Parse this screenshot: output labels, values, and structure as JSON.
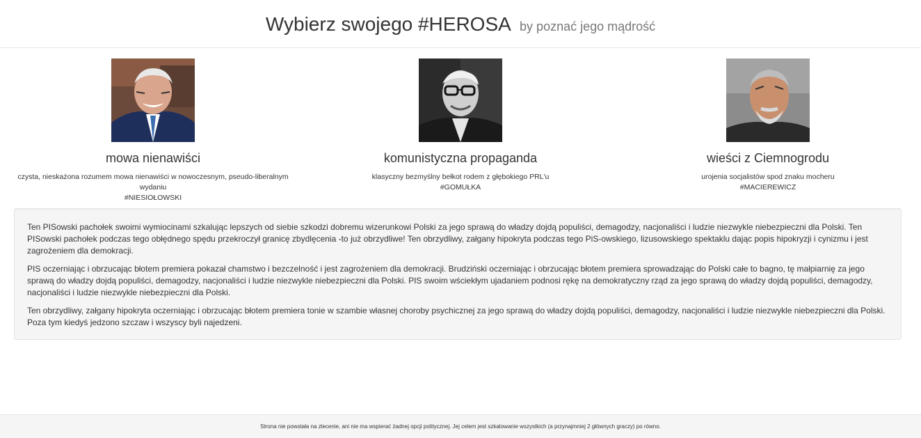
{
  "header": {
    "title": "Wybierz swojego #HEROSA",
    "subtitle": "by poznać jego mądrość"
  },
  "heroes": [
    {
      "name": "mowa nienawiści",
      "description": "czysta, nieskażona rozumem mowa nienawiści w nowoczesnym, pseudo-liberalnym wydaniu",
      "tag": "#NIESIOŁOWSKI"
    },
    {
      "name": "komunistyczna propaganda",
      "description": "klasyczny bezmyślny bełkot rodem z głębokiego PRL'u",
      "tag": "#GOMUŁKA"
    },
    {
      "name": "wieści z Ciemnogrodu",
      "description": "urojenia socjalistów spod znaku mocheru",
      "tag": "#MACIEREWICZ"
    }
  ],
  "wisdom": {
    "paragraphs": [
      "Ten PISowski pachołek swoimi wymiocinami szkalując lepszych od siebie szkodzi dobremu wizerunkowi Polski za jego sprawą do władzy dojdą populiści, demagodzy, nacjonaliści i ludzie niezwykle niebezpieczni dla Polski. Ten PISowski pachołek podczas tego obłędnego spędu przekroczył granicę zbydlęcenia -to już obrzydliwe! Ten obrzydliwy, załgany hipokryta podczas tego PiS-owskiego, lizusowskiego spektaklu dając popis hipokryzji i cynizmu i jest zagrożeniem dla demokracji.",
      "PIS oczerniając i obrzucając błotem premiera pokazał chamstwo i bezczelność i jest zagrożeniem dla demokracji. Brudziński oczerniając i obrzucając błotem premiera sprowadzając do Polski całe to bagno, tę małpiarnię za jego sprawą do władzy dojdą populiści, demagodzy, nacjonaliści i ludzie niezwykle niebezpieczni dla Polski. PIS swoim wściekłym ujadaniem podnosi rękę na demokratyczny rząd za jego sprawą do władzy dojdą populiści, demagodzy, nacjonaliści i ludzie niezwykle niebezpieczni dla Polski.",
      "Ten obrzydliwy, załgany hipokryta oczerniając i obrzucając błotem premiera tonie w szambie własnej choroby psychicznej za jego sprawą do władzy dojdą populiści, demagodzy, nacjonaliści i ludzie niezwykle niebezpieczni dla Polski. Poza tym kiedyś jedzono szczaw i wszyscy byli najedzeni."
    ]
  },
  "footer": {
    "text": "Strona nie powstała na zlecenie, ani nie ma wspierać żadnej opcji politycznej. Jej celem jest szkalowanie wszystkich (a przynajmniej 2 głównych graczy) po równo."
  }
}
